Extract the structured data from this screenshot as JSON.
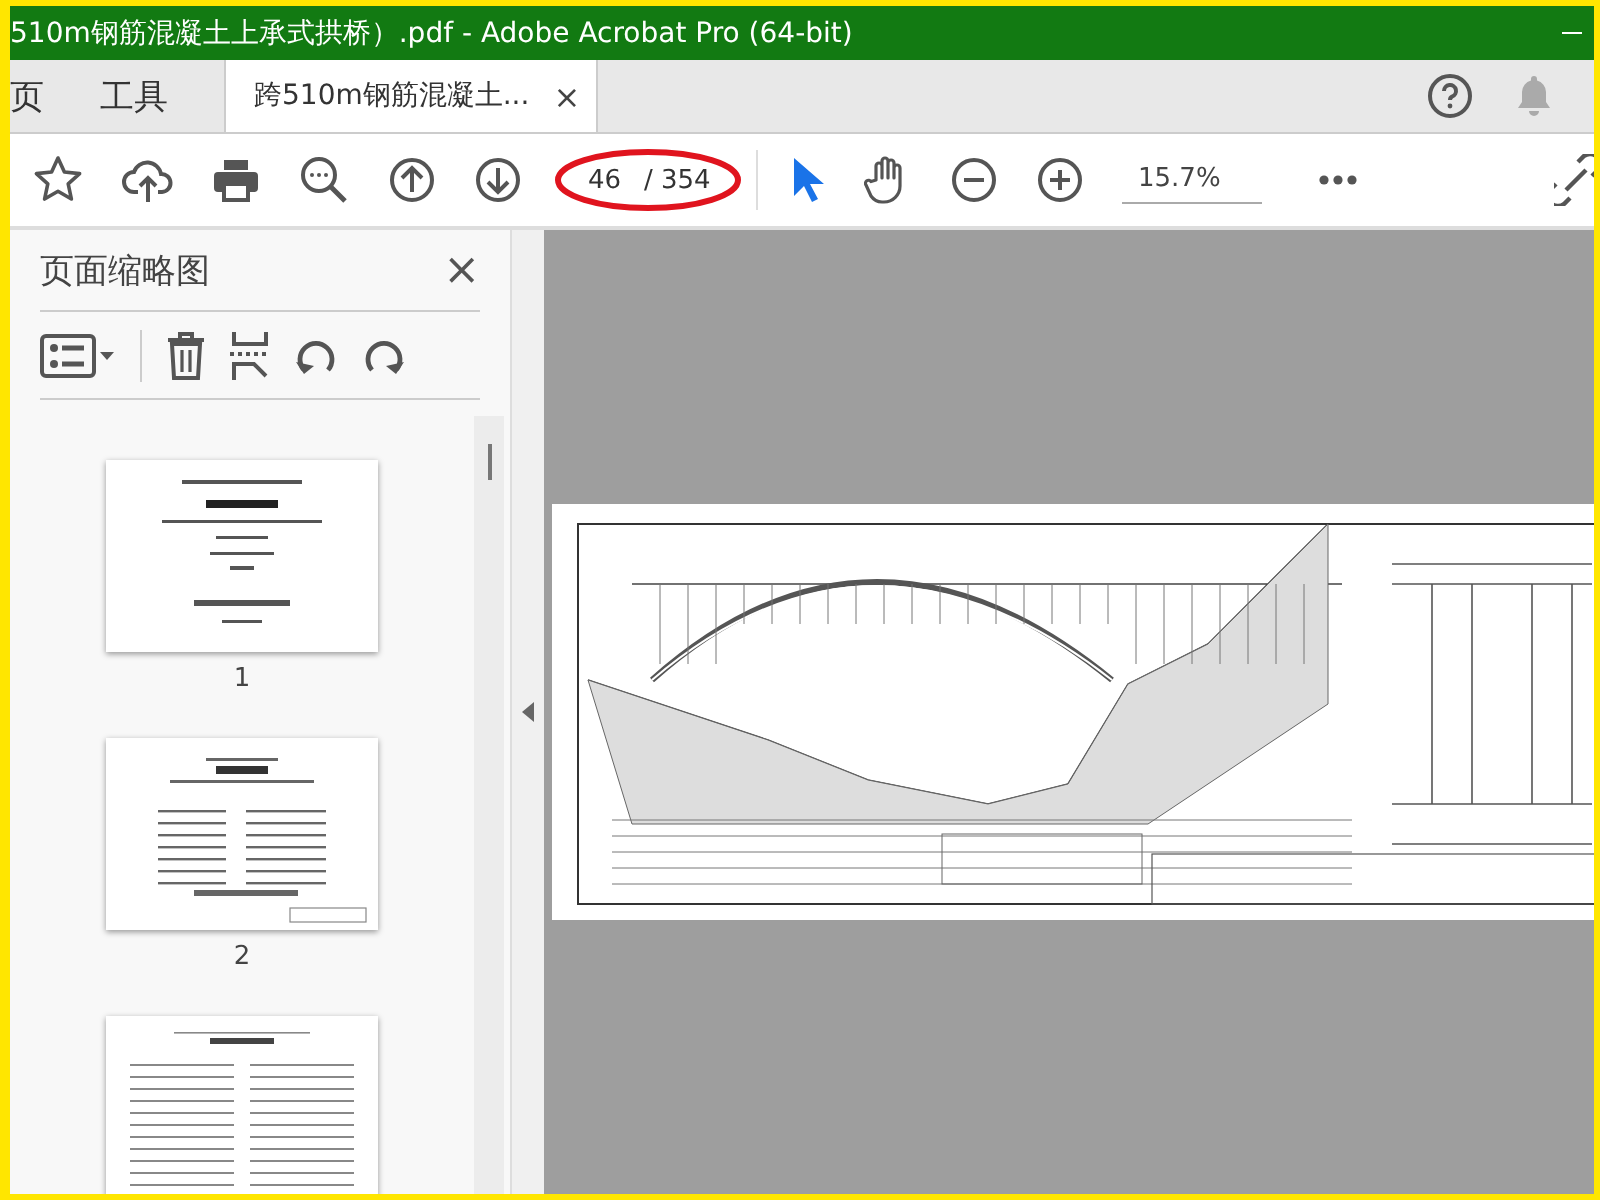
{
  "window": {
    "title": "510m钢筋混凝土上承式拱桥）.pdf - Adobe Acrobat Pro (64-bit)"
  },
  "tabs": [
    {
      "label": "页",
      "selected": false
    },
    {
      "label": "工具",
      "selected": false
    },
    {
      "label": "跨510m钢筋混凝土...",
      "selected": true,
      "close": "×"
    }
  ],
  "toolbar": {
    "page_number": "46",
    "page_total": "/ 354",
    "page_circled": true,
    "zoom": "15.7%",
    "select_tool_active": true
  },
  "sidebar": {
    "title": "页面缩略图",
    "close": "×",
    "thumbnails": [
      {
        "kind": "cover",
        "label": "1"
      },
      {
        "kind": "signatures",
        "label": "2"
      },
      {
        "kind": "text"
      }
    ]
  }
}
